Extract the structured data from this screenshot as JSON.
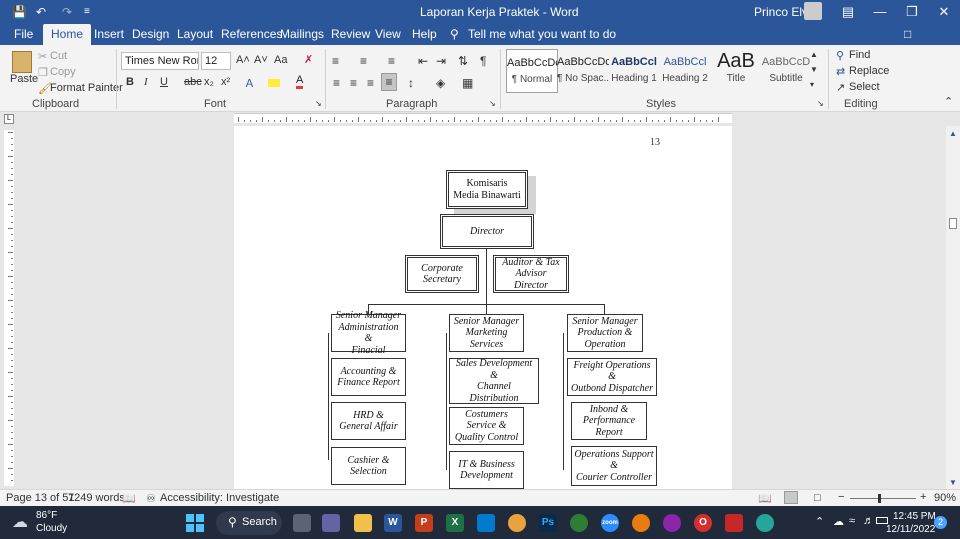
{
  "window": {
    "title": "Laporan Kerja Praktek  -  Word",
    "user": "Princo Elvin",
    "controls": {
      "ribbon_display": "ribbon-display-icon",
      "minimize": "minimize-icon",
      "restore": "restore-icon",
      "close": "close-icon"
    }
  },
  "quick_access": {
    "save": "save-icon",
    "undo": "undo-icon",
    "redo": "redo-icon",
    "customize": "customize-icon"
  },
  "tabs": [
    "File",
    "Home",
    "Insert",
    "Design",
    "Layout",
    "References",
    "Mailings",
    "Review",
    "View",
    "Help"
  ],
  "active_tab": "Home",
  "tell_me": "Tell me what you want to do",
  "clipboard": {
    "paste": "Paste",
    "cut": "Cut",
    "copy": "Copy",
    "format_painter": "Format Painter",
    "label": "Clipboard"
  },
  "font": {
    "name": "Times New Roma",
    "size": "12",
    "label": "Font",
    "bold": "B",
    "italic": "I",
    "underline": "U",
    "strike": "abc",
    "sub": "x₂",
    "sup": "x²",
    "case": "Aa",
    "grow": "A˄",
    "shrink": "A˅"
  },
  "paragraph": {
    "label": "Paragraph",
    "pilcrow": "¶"
  },
  "styles": {
    "label": "Styles",
    "items": [
      {
        "preview": "AaBbCcDc",
        "name": "¶ Normal"
      },
      {
        "preview": "AaBbCcDc",
        "name": "¶ No Spac..."
      },
      {
        "preview": "AaBbCcl",
        "name": "Heading 1"
      },
      {
        "preview": "AaBbCcl",
        "name": "Heading 2"
      },
      {
        "preview": "AaB",
        "name": "Title"
      },
      {
        "preview": "AaBbCcD",
        "name": "Subtitle"
      }
    ]
  },
  "editing": {
    "label": "Editing",
    "find": "Find",
    "replace": "Replace",
    "select": "Select"
  },
  "page_number": "13",
  "org_chart": {
    "top": "Komisaris\nMedia Binawarti",
    "director": "Director",
    "corporate_secretary": "Corporate\nSecretary",
    "auditor": "Auditor & Tax\nAdvisor Director",
    "columns": [
      {
        "head": "Senior Manager\nAdministration &\nFinacial",
        "items": [
          "Accounting &\nFinance Report",
          "HRD &\nGeneral Affair",
          "Cashier &\nSelection"
        ]
      },
      {
        "head": "Senior Manager\nMarketing\nServices",
        "items": [
          "Sales Development &\nChannel Distribution",
          "Costumers\nService &\nQuality Control",
          "IT & Business\nDevelopment"
        ]
      },
      {
        "head": "Senior Manager\nProduction &\nOperation",
        "items": [
          "Freight Operations &\nOutbond Dispatcher",
          "Inbond &\nPerformance\nReport",
          "Operations Support\n&\nCourier Controller"
        ]
      }
    ]
  },
  "status": {
    "page": "Page 13 of 51",
    "words": "7249 words",
    "accessibility": "Accessibility: Investigate",
    "zoom": "90%",
    "zoom_level_percent": 90
  },
  "taskbar": {
    "weather_temp": "86°F",
    "weather_desc": "Cloudy",
    "search": "Search",
    "time": "12:45 PM",
    "date": "12/11/2022",
    "notifications": "2",
    "apps": [
      "task-view-icon",
      "meet-icon",
      "file-explorer-icon",
      "word-icon",
      "powerpoint-icon",
      "excel-icon",
      "vscode-icon",
      "chrome-icon",
      "photoshop-icon",
      "app-icon",
      "zoom-icon",
      "blender-icon",
      "app-icon",
      "opera-icon",
      "acrobat-icon",
      "globe-icon"
    ]
  }
}
